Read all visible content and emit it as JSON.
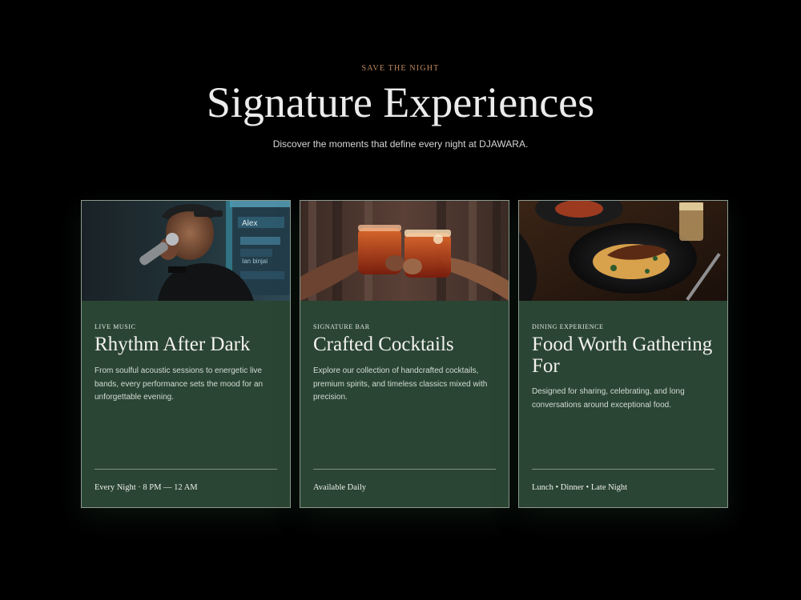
{
  "header": {
    "eyebrow": "SAVE THE NIGHT",
    "title": "Signature Experiences",
    "subtitle": "Discover the moments that define every night at DJAWARA."
  },
  "cards": [
    {
      "tag": "LIVE MUSIC",
      "title": "Rhythm After Dark",
      "description": "From soulful acoustic sessions to energetic live bands, every performance sets the mood for an unforgettable evening.",
      "meta": "Every Night · 8 PM — 12 AM",
      "photo_icon": "singer-photo",
      "photo_text_1": "Alex",
      "photo_text_2": "Ian binjai"
    },
    {
      "tag": "SIGNATURE BAR",
      "title": "Crafted Cocktails",
      "description": "Explore our collection of handcrafted cocktails, premium spirits, and timeless classics mixed with precision.",
      "meta": "Available Daily",
      "photo_icon": "cocktail-toast-photo"
    },
    {
      "tag": "DINING EXPERIENCE",
      "title": "Food Worth Gathering For",
      "description": "Designed for sharing, celebrating, and long conversations around exceptional food.",
      "meta": "Lunch • Dinner • Late Night",
      "photo_icon": "dinner-plate-photo"
    }
  ],
  "colors": {
    "background": "#000000",
    "card": "#2a4533",
    "eyebrow": "#c08a5e",
    "title": "#ececec"
  }
}
